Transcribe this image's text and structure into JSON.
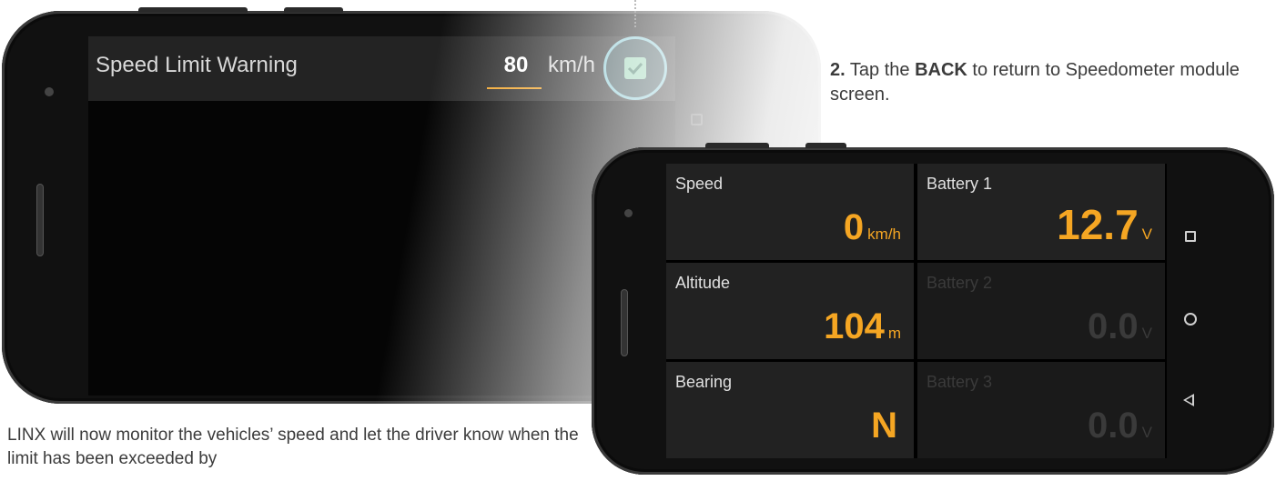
{
  "settings_screen": {
    "row_label": "Speed Limit Warning",
    "speed_value": "80",
    "speed_unit": "km/h",
    "checkbox_checked": true,
    "accent_color": "#f0a020",
    "checkbox_color": "#8fd0ae"
  },
  "instructions": {
    "step_number": "2.",
    "step_text_before": "Tap the",
    "step_bold": "BACK",
    "step_text_after": "to return to Speedometer module screen.",
    "bottom_text": "LINX will now monitor the vehicles’ speed and let the driver know when the limit has been exceeded by"
  },
  "speedometer_screen": {
    "tiles": [
      {
        "label": "Speed",
        "value": "0",
        "unit": "km/h",
        "active": true
      },
      {
        "label": "Battery 1",
        "value": "12.7",
        "unit": "V",
        "active": true
      },
      {
        "label": "Altitude",
        "value": "104",
        "unit": "m",
        "active": true
      },
      {
        "label": "Battery 2",
        "value": "0.0",
        "unit": "V",
        "active": false
      },
      {
        "label": "Bearing",
        "value": "N",
        "unit": "",
        "active": true
      },
      {
        "label": "Battery 3",
        "value": "0.0",
        "unit": "V",
        "active": false
      }
    ],
    "value_color": "#f5a623",
    "nav_icons": [
      "recents-square-icon",
      "home-circle-icon",
      "back-triangle-icon"
    ]
  }
}
